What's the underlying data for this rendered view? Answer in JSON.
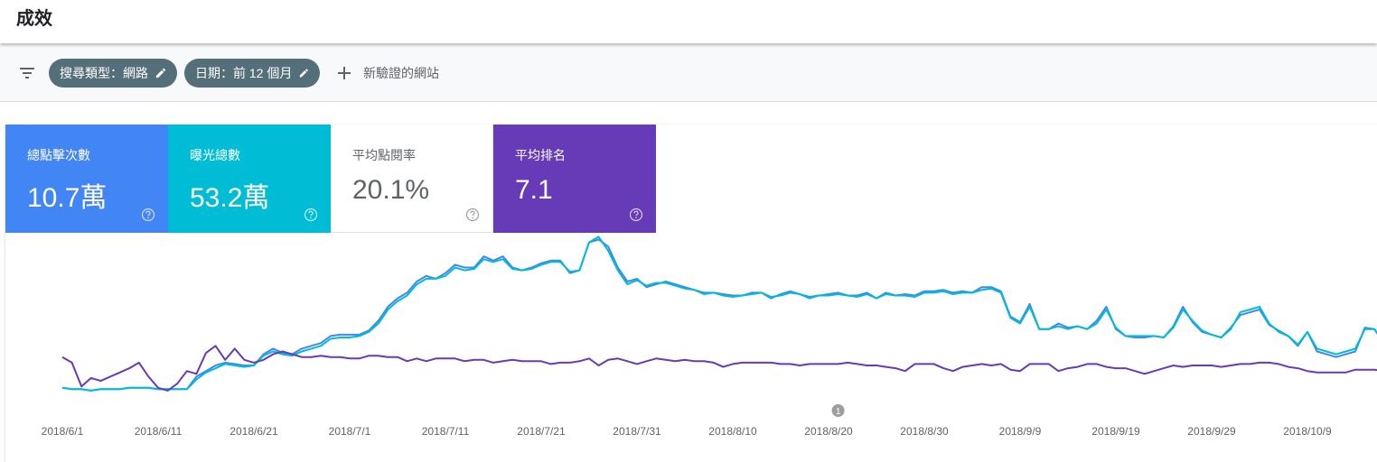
{
  "header": {
    "title": "成效"
  },
  "filters": {
    "search_type_chip": "搜尋類型：網路",
    "date_chip": "日期：前 12 個月",
    "add_site_label": "新驗證的網站"
  },
  "metrics": [
    {
      "label": "總點擊次數",
      "value": "10.7萬",
      "color": "#4285f4"
    },
    {
      "label": "曝光總數",
      "value": "53.2萬",
      "color": "#00bcd4"
    },
    {
      "label": "平均點閱率",
      "value": "20.1%",
      "color": "#ffffff"
    },
    {
      "label": "平均排名",
      "value": "7.1",
      "color": "#673ab7"
    }
  ],
  "icons": {
    "filter": "filter-list-icon",
    "edit": "pencil-icon",
    "add": "plus-icon",
    "help": "help-circle-icon"
  },
  "chart_data": {
    "type": "line",
    "x_ticks": [
      "2018/6/1",
      "2018/6/11",
      "2018/6/21",
      "2018/7/1",
      "2018/7/11",
      "2018/7/21",
      "2018/7/31",
      "2018/8/10",
      "2018/8/20",
      "2018/8/30",
      "2018/9/9",
      "2018/9/19",
      "2018/9/29",
      "2018/10/9"
    ],
    "annotation": {
      "text": "1",
      "date_index": 81
    },
    "axis_note": "values are relative (0-100 scale), no y-axis labels shown",
    "series": [
      {
        "color": "#4285f4",
        "values": [
          4,
          3,
          3,
          2,
          3,
          3,
          3,
          4,
          4,
          4,
          3,
          3,
          3,
          3,
          12,
          16,
          20,
          22,
          21,
          20,
          20,
          28,
          32,
          29,
          28,
          32,
          34,
          36,
          41,
          42,
          42,
          42,
          45,
          52,
          62,
          68,
          72,
          80,
          84,
          82,
          86,
          92,
          90,
          90,
          98,
          95,
          98,
          90,
          88,
          90,
          93,
          95,
          95,
          86,
          88,
          108,
          110,
          105,
          90,
          80,
          82,
          76,
          78,
          80,
          78,
          76,
          74,
          72,
          72,
          71,
          70,
          70,
          72,
          72,
          68,
          71,
          73,
          71,
          69,
          70,
          71,
          72,
          70,
          70,
          72,
          68,
          72,
          70,
          71,
          70,
          73,
          73,
          74,
          72,
          73,
          72,
          76,
          76,
          73,
          55,
          51,
          64,
          46,
          46,
          50,
          47,
          48,
          46,
          52,
          62,
          46,
          41,
          40,
          40,
          41,
          40,
          48,
          62,
          51,
          44,
          42,
          40,
          47,
          56,
          58,
          60,
          49,
          45,
          41,
          34,
          44,
          30,
          28,
          26,
          28,
          30,
          47,
          46,
          35,
          42,
          32,
          48,
          40,
          28,
          40,
          45,
          50,
          56
        ]
      },
      {
        "color": "#00bcd4",
        "values": [
          4,
          3,
          3,
          2,
          3,
          3,
          3,
          4,
          4,
          4,
          3,
          3,
          3,
          3,
          10,
          15,
          18,
          21,
          20,
          19,
          20,
          27,
          30,
          28,
          27,
          30,
          32,
          34,
          39,
          40,
          40,
          41,
          44,
          50,
          60,
          66,
          70,
          78,
          82,
          82,
          84,
          90,
          88,
          89,
          96,
          94,
          96,
          89,
          88,
          89,
          92,
          94,
          94,
          87,
          88,
          108,
          112,
          102,
          88,
          78,
          81,
          77,
          79,
          79,
          77,
          75,
          74,
          71,
          72,
          70,
          69,
          70,
          71,
          72,
          69,
          70,
          72,
          71,
          68,
          70,
          70,
          71,
          70,
          69,
          71,
          68,
          71,
          70,
          70,
          69,
          72,
          72,
          73,
          71,
          72,
          72,
          74,
          75,
          72,
          54,
          50,
          62,
          46,
          46,
          48,
          46,
          48,
          46,
          50,
          60,
          47,
          41,
          41,
          41,
          41,
          40,
          47,
          60,
          52,
          45,
          42,
          40,
          46,
          58,
          60,
          62,
          50,
          44,
          41,
          35,
          44,
          32,
          30,
          28,
          30,
          32,
          46,
          46,
          36,
          41,
          33,
          46,
          40,
          28,
          40,
          44,
          50,
          56
        ]
      },
      {
        "color": "#673ab7",
        "values": [
          26,
          22,
          5,
          11,
          9,
          12,
          15,
          18,
          22,
          12,
          4,
          2,
          7,
          16,
          14,
          29,
          34,
          24,
          32,
          24,
          22,
          24,
          28,
          30,
          28,
          26,
          26,
          27,
          26,
          26,
          25,
          25,
          27,
          27,
          26,
          26,
          23,
          25,
          23,
          25,
          25,
          25,
          23,
          24,
          24,
          22,
          23,
          24,
          23,
          23,
          23,
          21,
          22,
          22,
          23,
          25,
          20,
          24,
          25,
          23,
          21,
          23,
          25,
          24,
          23,
          24,
          23,
          23,
          22,
          19,
          21,
          22,
          22,
          22,
          22,
          21,
          21,
          20,
          21,
          21,
          21,
          21,
          22,
          21,
          20,
          20,
          19,
          18,
          16,
          21,
          21,
          21,
          18,
          16,
          19,
          20,
          21,
          20,
          21,
          17,
          16,
          21,
          21,
          21,
          16,
          18,
          19,
          21,
          21,
          19,
          18,
          18,
          16,
          14,
          16,
          18,
          20,
          19,
          20,
          20,
          20,
          19,
          20,
          21,
          21,
          22,
          22,
          21,
          19,
          18,
          16,
          15,
          15,
          15,
          15,
          17,
          17,
          17,
          16,
          16,
          16,
          15,
          15,
          14,
          16,
          16,
          16,
          17
        ]
      }
    ]
  }
}
